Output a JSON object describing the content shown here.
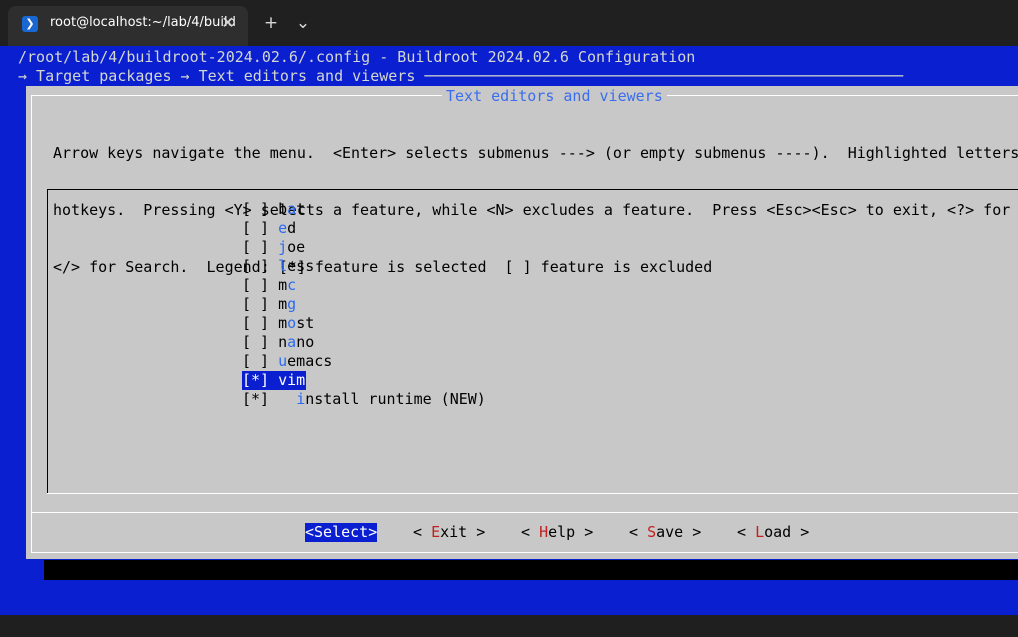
{
  "window": {
    "tab_title": "root@localhost:~/lab/4/build",
    "close_glyph": "✕",
    "new_tab_glyph": "+",
    "dropdown_glyph": "⌄",
    "tab_icon_glyph": "❯"
  },
  "header": {
    "path_line": "/root/lab/4/buildroot-2024.02.6/.config - Buildroot 2024.02.6 Configuration",
    "breadcrumb_line": "→ Target packages → Text editors and viewers ─────────────────────────────────────────────────────"
  },
  "dialog": {
    "title": "Text editors and viewers",
    "help_lines": [
      "Arrow keys navigate the menu.  <Enter> selects submenus ---> (or empty submenus ----).  Highlighted letters are",
      "hotkeys.  Pressing <Y> selects a feature, while <N> excludes a feature.  Press <Esc><Esc> to exit, <?> for Help,",
      "</> for Search.  Legend: [*] feature is selected  [ ] feature is excluded"
    ]
  },
  "menu": {
    "items": [
      {
        "check": "[ ]",
        "pre": "",
        "hot": "",
        "rest": "",
        "label_pre": "b",
        "label_hot": "a",
        "label_rest": "t"
      },
      {
        "check": "[ ]",
        "label_pre": "",
        "label_hot": "e",
        "label_rest": "d"
      },
      {
        "check": "[ ]",
        "label_pre": "",
        "label_hot": "j",
        "label_rest": "oe"
      },
      {
        "check": "[ ]",
        "label_pre": "",
        "label_hot": "l",
        "label_rest": "ess"
      },
      {
        "check": "[ ]",
        "label_pre": "m",
        "label_hot": "c",
        "label_rest": ""
      },
      {
        "check": "[ ]",
        "label_pre": "m",
        "label_hot": "g",
        "label_rest": ""
      },
      {
        "check": "[ ]",
        "label_pre": "m",
        "label_hot": "o",
        "label_rest": "st"
      },
      {
        "check": "[ ]",
        "label_pre": "n",
        "label_hot": "a",
        "label_rest": "no"
      },
      {
        "check": "[ ]",
        "label_pre": "",
        "label_hot": "u",
        "label_rest": "emacs"
      },
      {
        "check": "[*]",
        "label_pre": "",
        "label_hot": "v",
        "label_rest": "im"
      },
      {
        "check": "[*]",
        "label_pre": "  ",
        "label_hot": "i",
        "label_rest": "nstall runtime (NEW)"
      }
    ],
    "selected_index": 9
  },
  "buttons": {
    "select": {
      "text": "<Select>"
    },
    "exit": {
      "pre": "< ",
      "hot": "E",
      "rest": "xit >"
    },
    "help": {
      "pre": "< ",
      "hot": "H",
      "rest": "elp >"
    },
    "save": {
      "pre": "< ",
      "hot": "S",
      "rest": "ave >"
    },
    "load": {
      "pre": "< ",
      "hot": "L",
      "rest": "oad >"
    }
  },
  "colors": {
    "terminal_blue": "#0a1fcf",
    "dialog_gray": "#c8c8c8",
    "hotkey_blue": "#2d6af0",
    "button_hotkey_red": "#c0211f"
  }
}
